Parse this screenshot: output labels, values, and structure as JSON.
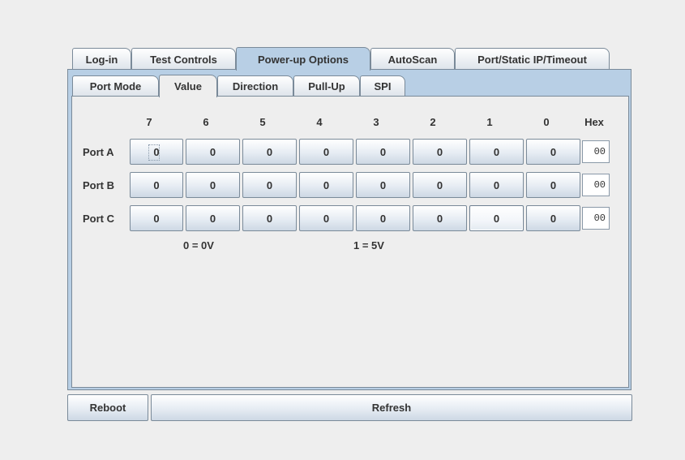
{
  "main_tabs": [
    "Log-in",
    "Test Controls",
    "Power-up Options",
    "AutoScan",
    "Port/Static IP/Timeout"
  ],
  "main_tab_selected": "Power-up Options",
  "sub_tabs": [
    "Port Mode",
    "Value",
    "Direction",
    "Pull-Up",
    "SPI"
  ],
  "sub_tab_selected": "Value",
  "grid": {
    "column_headers": [
      "7",
      "6",
      "5",
      "4",
      "3",
      "2",
      "1",
      "0"
    ],
    "hex_header": "Hex",
    "rows": [
      {
        "label": "Port A",
        "bits": [
          "0",
          "0",
          "0",
          "0",
          "0",
          "0",
          "0",
          "0"
        ],
        "hex": "00"
      },
      {
        "label": "Port B",
        "bits": [
          "0",
          "0",
          "0",
          "0",
          "0",
          "0",
          "0",
          "0"
        ],
        "hex": "00"
      },
      {
        "label": "Port C",
        "bits": [
          "0",
          "0",
          "0",
          "0",
          "0",
          "0",
          "0",
          "0"
        ],
        "hex": "00"
      }
    ]
  },
  "legend": {
    "low": "0 = 0V",
    "high": "1 = 5V"
  },
  "buttons": {
    "reboot": "Reboot",
    "refresh": "Refresh"
  }
}
